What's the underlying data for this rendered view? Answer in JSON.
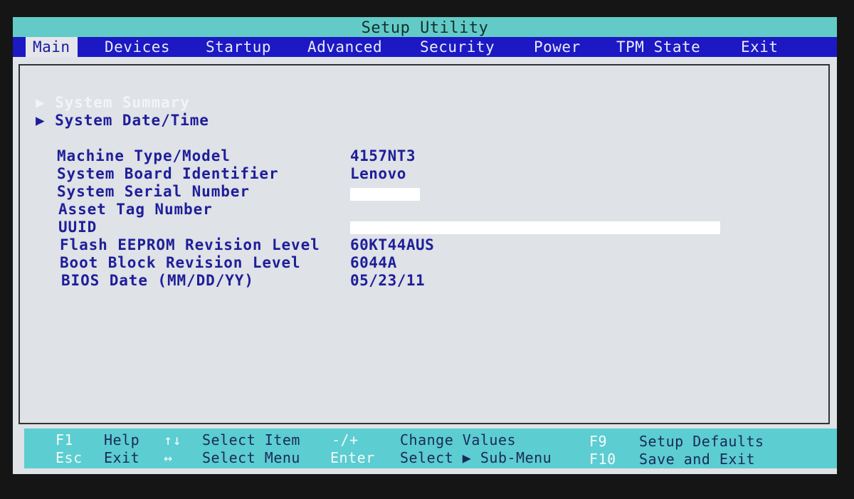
{
  "title": "Setup Utility",
  "menu": [
    {
      "label": "Main",
      "active": true
    },
    {
      "label": "Devices"
    },
    {
      "label": "Startup"
    },
    {
      "label": "Advanced"
    },
    {
      "label": "Security"
    },
    {
      "label": "Power"
    },
    {
      "label": "TPM State"
    },
    {
      "label": "Exit"
    }
  ],
  "submenus": [
    {
      "label": "System Summary",
      "icon": "triangle-right-icon"
    },
    {
      "label": "System Date/Time",
      "icon": "triangle-right-icon"
    }
  ],
  "fields": [
    {
      "label": "Machine Type/Model",
      "value": "4157NT3"
    },
    {
      "label": "System Board Identifier",
      "value": "Lenovo"
    },
    {
      "label": "System Serial Number",
      "value": "",
      "redacted": true
    },
    {
      "label": "Asset Tag Number",
      "value": ""
    },
    {
      "label": "UUID",
      "value": "",
      "redacted": true
    },
    {
      "label": "Flash EEPROM Revision Level",
      "value": "60KT44AUS"
    },
    {
      "label": "Boot Block Revision Level",
      "value": "6044A"
    },
    {
      "label": "BIOS Date (MM/DD/YY)",
      "value": "05/23/11"
    }
  ],
  "footer": [
    {
      "key": "F1",
      "desc": "Help"
    },
    {
      "key": "Esc",
      "desc": "Exit"
    },
    {
      "key": "↑↓",
      "desc": "Select Item"
    },
    {
      "key": "↔",
      "desc": "Select Menu"
    },
    {
      "key": "-/+",
      "desc": "Change Values"
    },
    {
      "key": "Enter",
      "desc": "Select ▶ Sub-Menu"
    },
    {
      "key": "F9",
      "desc": "Setup Defaults"
    },
    {
      "key": "F10",
      "desc": "Save and Exit"
    }
  ],
  "colors": {
    "title_bar": "#63cbc7",
    "menu_bar": "#1c18c4",
    "background": "#dfe2e6",
    "text": "#1e1e9a"
  }
}
